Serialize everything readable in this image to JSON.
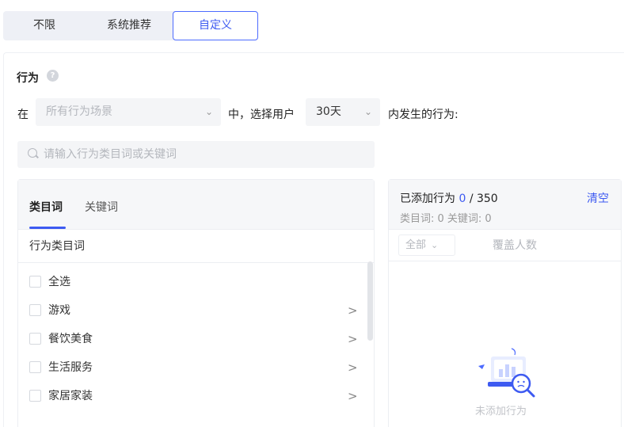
{
  "mode_tabs": [
    "不限",
    "系统推荐",
    "自定义"
  ],
  "behavior": {
    "title": "行为",
    "help_icon": "question-circle-icon",
    "prefix_label": "在",
    "scene_select": {
      "placeholder": "所有行为场景"
    },
    "middle_label": "中，选择用户",
    "days_select": {
      "value": "30天"
    },
    "suffix_label": "内发生的行为:",
    "search_placeholder": "请输入行为类目词或关键词"
  },
  "left_panel": {
    "tabs": [
      "类目词",
      "关键词"
    ],
    "header": "行为类目词",
    "rows": [
      {
        "label": "全选",
        "has_arrow": false
      },
      {
        "label": "游戏",
        "has_arrow": true
      },
      {
        "label": "餐饮美食",
        "has_arrow": true
      },
      {
        "label": "生活服务",
        "has_arrow": true
      },
      {
        "label": "家居家装",
        "has_arrow": true
      }
    ],
    "arrow_glyph": ">"
  },
  "right_panel": {
    "added_label": "已添加行为",
    "added_count": "0",
    "added_max": "/ 350",
    "stats": "类目词: 0   关键词: 0",
    "clear_label": "清空",
    "filter_label": "全部",
    "cover_label": "覆盖人数",
    "empty_text": "未添加行为"
  },
  "colors": {
    "accent": "#3d5af1",
    "panel_bg": "#f6f7f9",
    "input_bg": "#f4f5f7"
  }
}
